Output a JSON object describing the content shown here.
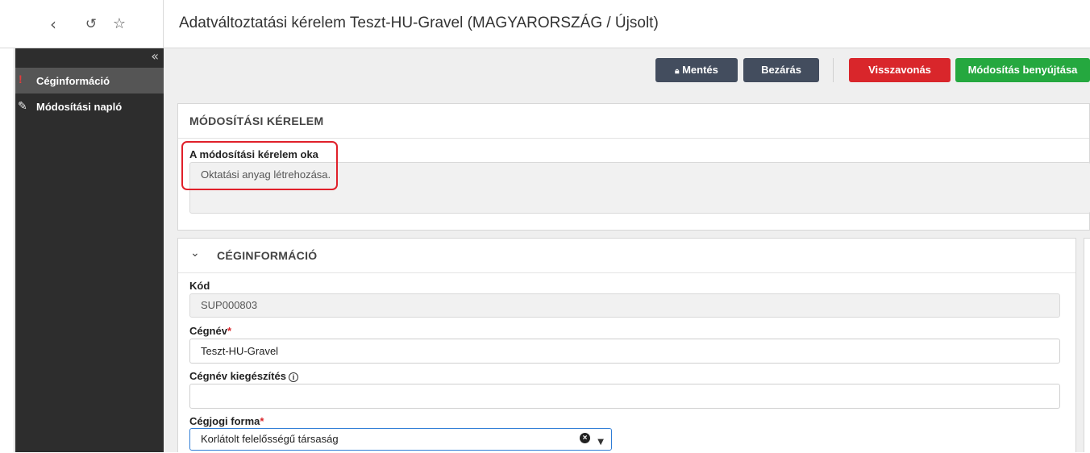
{
  "header": {
    "title": "Adatváltoztatási kérelem Teszt-HU-Gravel (MAGYARORSZÁG / Újsolt)",
    "icons": [
      "back-icon",
      "history-icon",
      "star-icon"
    ]
  },
  "sidebar": {
    "collapse_label": "«",
    "items": [
      {
        "label": "Céginformáció",
        "active": true,
        "marker": "!"
      },
      {
        "label": "Módosítási napló",
        "active": false,
        "icon": "edit-icon"
      }
    ]
  },
  "toolbar": {
    "save_label": "Mentés",
    "save_icon": "lock-icon",
    "close_label": "Bezárás",
    "cancel_label": "Visszavonás",
    "submit_label": "Módosítás benyújtása"
  },
  "request_section": {
    "title": "MÓDOSÍTÁSI KÉRELEM",
    "reason_label": "A módosítási kérelem oka",
    "reason_value": "Oktatási anyag létrehozása."
  },
  "company_section": {
    "title": "CÉGINFORMÁCIÓ",
    "code_label": "Kód",
    "code_value": "SUP000803",
    "name_label": "Cégnév",
    "name_value": "Teszt-HU-Gravel",
    "name_suffix_label": "Cégnév kiegészítés",
    "name_suffix_value": "",
    "legal_form_label": "Cégjogi forma",
    "legal_form_value": "Korlátolt felelősségű társaság",
    "required_mark": "*"
  },
  "colors": {
    "sidebar_bg": "#2d2d2d",
    "dark_button": "#434d5e",
    "danger_button": "#d9262b",
    "success_button": "#25a83f",
    "highlight_border": "#e0202a"
  }
}
